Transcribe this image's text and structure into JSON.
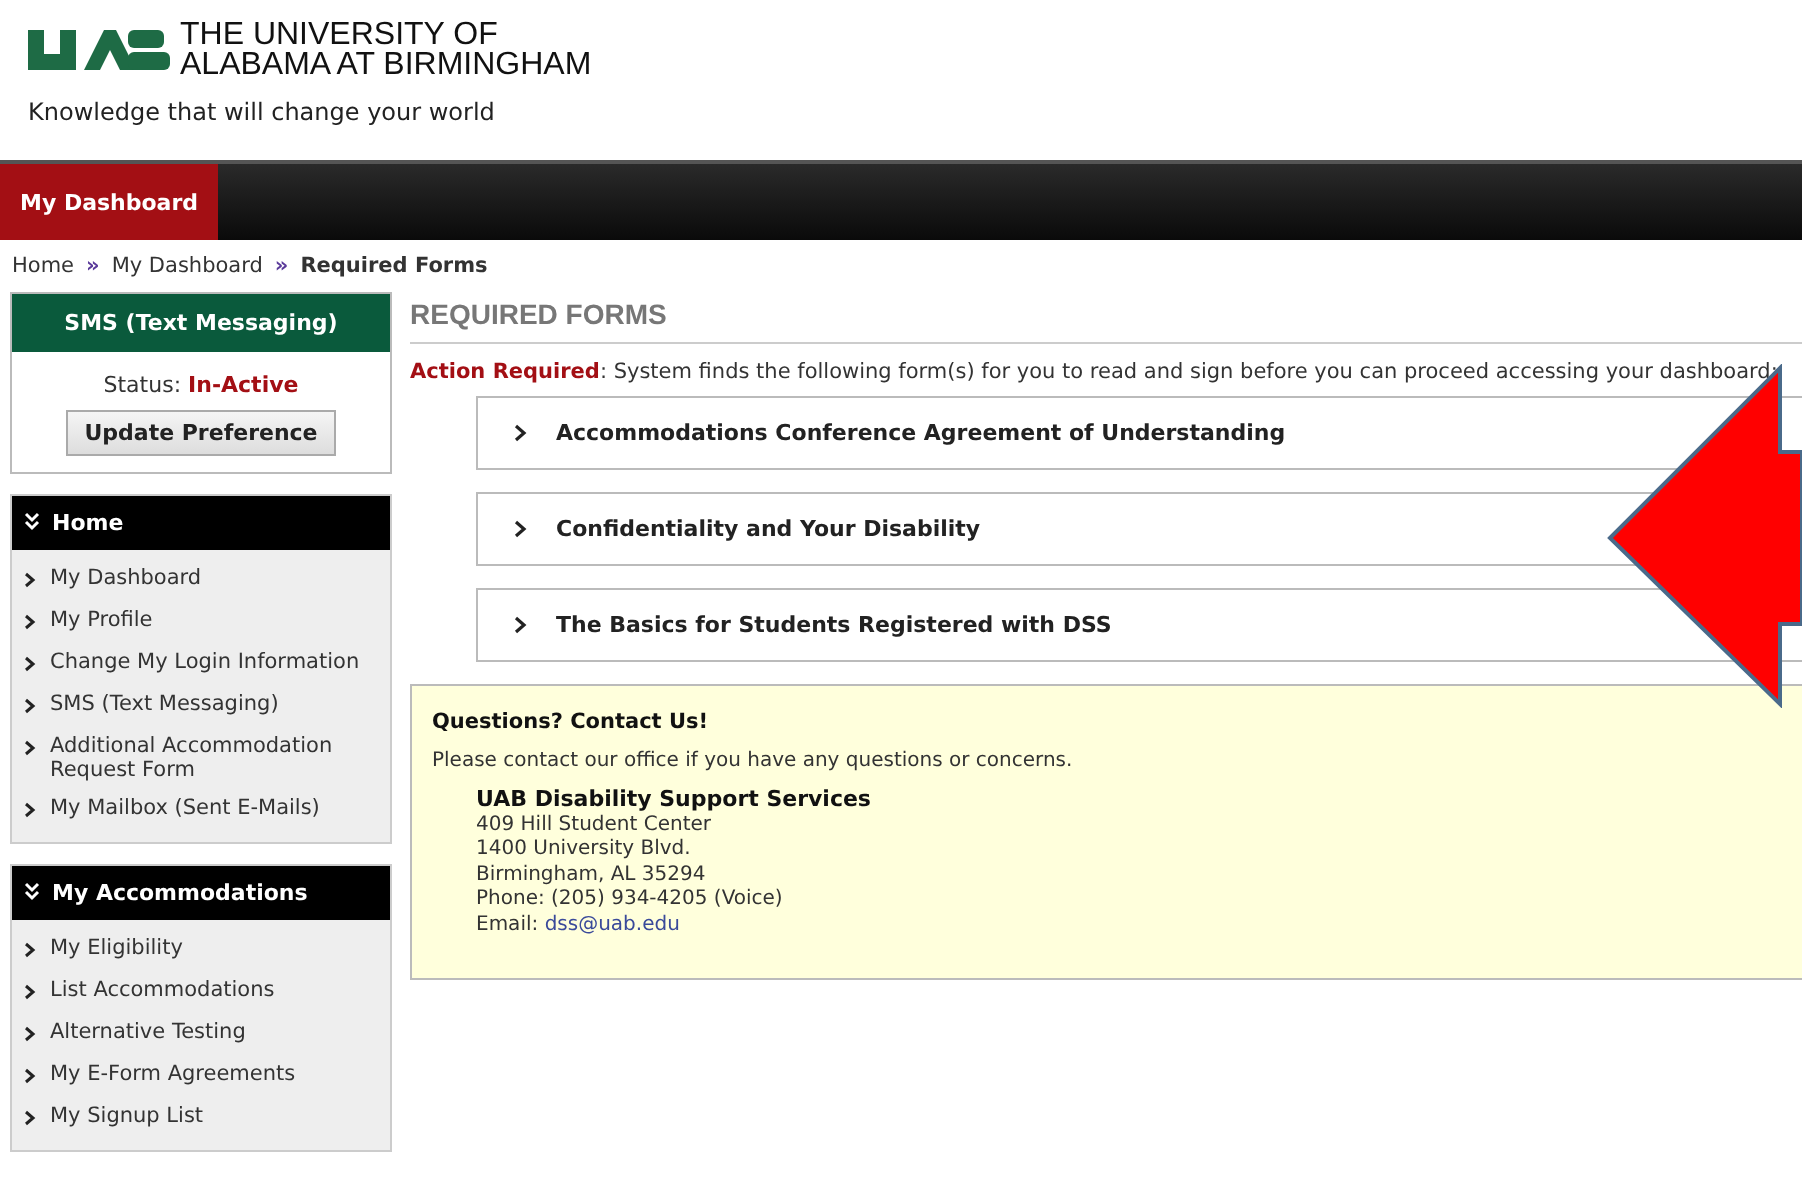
{
  "header": {
    "university_line_1": "THE UNIVERSITY OF",
    "university_line_2": "ALABAMA AT BIRMINGHAM",
    "tagline": "Knowledge that will change your world"
  },
  "nav": {
    "tabs": [
      {
        "label": "My Dashboard",
        "selected": true
      }
    ]
  },
  "breadcrumb": {
    "separator": "»",
    "items": [
      {
        "label": "Home",
        "current": false
      },
      {
        "label": "My Dashboard",
        "current": false
      },
      {
        "label": "Required Forms",
        "current": true
      }
    ]
  },
  "sms_panel": {
    "title": "SMS (Text Messaging)",
    "status_label": "Status:",
    "status_value": "In-Active",
    "button": "Update Preference"
  },
  "sidebar": {
    "sections": [
      {
        "title": "Home",
        "items": [
          "My Dashboard",
          "My Profile",
          "Change My Login Information",
          "SMS (Text Messaging)",
          "Additional Accommodation Request Form",
          "My Mailbox (Sent E-Mails)"
        ]
      },
      {
        "title": "My Accommodations",
        "items": [
          "My Eligibility",
          "List Accommodations",
          "Alternative Testing",
          "My E-Form Agreements",
          "My Signup List"
        ]
      }
    ]
  },
  "main": {
    "heading": "REQUIRED FORMS",
    "notice_label": "Action Required",
    "notice_text": ": System finds the following form(s) for you to read and sign before you can proceed accessing your dashboard:",
    "forms": [
      {
        "title": "Accommodations Conference Agreement of Understanding",
        "expanded": false
      },
      {
        "title": "Confidentiality and Your Disability",
        "expanded": false
      },
      {
        "title": "The Basics for Students Registered with DSS",
        "expanded": false
      }
    ],
    "contact": {
      "title": "Questions? Contact Us!",
      "intro": "Please contact our office if you have any questions or concerns.",
      "office": "UAB Disability Support Services",
      "address_lines": [
        "409 Hill Student Center",
        "1400 University Blvd.",
        "Birmingham, AL 35294",
        "Phone: (205) 934-4205 (Voice)"
      ],
      "email_label": "Email:",
      "email": "dss@uab.edu"
    }
  }
}
